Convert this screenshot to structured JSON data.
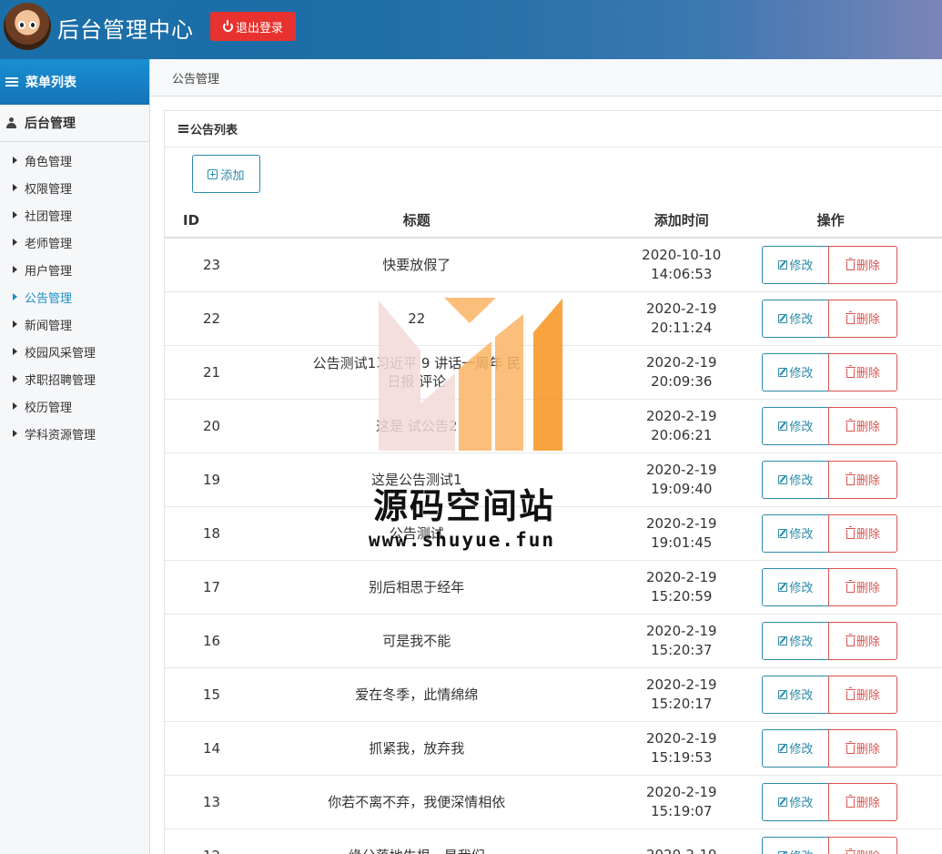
{
  "header": {
    "app_title": "后台管理中心",
    "logout_label": "退出登录"
  },
  "sidebar": {
    "menu_title": "菜单列表",
    "group_title": "后台管理",
    "items": [
      {
        "label": "角色管理",
        "active": false
      },
      {
        "label": "权限管理",
        "active": false
      },
      {
        "label": "社团管理",
        "active": false
      },
      {
        "label": "老师管理",
        "active": false
      },
      {
        "label": "用户管理",
        "active": false
      },
      {
        "label": "公告管理",
        "active": true
      },
      {
        "label": "新闻管理",
        "active": false
      },
      {
        "label": "校园风采管理",
        "active": false
      },
      {
        "label": "求职招聘管理",
        "active": false
      },
      {
        "label": "校历管理",
        "active": false
      },
      {
        "label": "学科资源管理",
        "active": false
      }
    ]
  },
  "breadcrumb": "公告管理",
  "panel": {
    "heading": "公告列表",
    "add_label": "添加",
    "columns": {
      "id": "ID",
      "title": "标题",
      "time": "添加时间",
      "ops": "操作"
    },
    "edit_label": "修改",
    "delete_label": "删除",
    "rows": [
      {
        "id": "23",
        "title": "快要放假了",
        "date": "2020-10-10",
        "time": "14:06:53"
      },
      {
        "id": "22",
        "title": "22",
        "date": "2020-2-19",
        "time": "20:11:24"
      },
      {
        "id": "21",
        "title": "公告测试1习近平 9 讲话一周年 民",
        "title2": "日报 评论",
        "date": "2020-2-19",
        "time": "20:09:36"
      },
      {
        "id": "20",
        "title": "这是 试公告2",
        "date": "2020-2-19",
        "time": "20:06:21"
      },
      {
        "id": "19",
        "title": "这是公告测试1",
        "date": "2020-2-19",
        "time": "19:09:40"
      },
      {
        "id": "18",
        "title": "公告测试",
        "date": "2020-2-19",
        "time": "19:01:45"
      },
      {
        "id": "17",
        "title": "别后相思于经年",
        "date": "2020-2-19",
        "time": "15:20:59"
      },
      {
        "id": "16",
        "title": "可是我不能",
        "date": "2020-2-19",
        "time": "15:20:37"
      },
      {
        "id": "15",
        "title": "爱在冬季，此情绵绵",
        "date": "2020-2-19",
        "time": "15:20:17"
      },
      {
        "id": "14",
        "title": "抓紧我，放弃我",
        "date": "2020-2-19",
        "time": "15:19:53"
      },
      {
        "id": "13",
        "title": "你若不离不弃，我便深情相依",
        "date": "2020-2-19",
        "time": "15:19:07"
      },
      {
        "id": "12",
        "title": "缘分落地生根，是我们",
        "date": "2020-2-19",
        "time": ""
      }
    ]
  },
  "watermark": {
    "text_cn": "源码空间站",
    "url": "www.shuyue.fun",
    "colors": {
      "orange": "#f7931e",
      "light_orange": "#fbb565",
      "pink": "#f3d9d9"
    }
  }
}
